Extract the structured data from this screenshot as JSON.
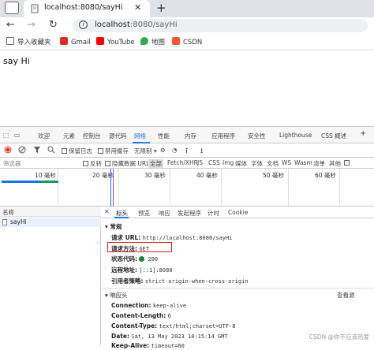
{
  "browser": {
    "tab_title": "localhost:8080/sayHi",
    "url_host": "localhost",
    "url_path": ":8080/sayHi"
  },
  "bookmarks": [
    {
      "label": "导入收藏夹",
      "icon": "import-bookmarks-icon",
      "color": "#666"
    },
    {
      "label": "Gmail",
      "icon": "gmail-icon",
      "color": "#d93025"
    },
    {
      "label": "YouTube",
      "icon": "youtube-icon",
      "color": "#ff0000"
    },
    {
      "label": "地图",
      "icon": "maps-icon",
      "color": "#34a853"
    },
    {
      "label": "CSDN",
      "icon": "csdn-icon",
      "color": "#fc5531"
    }
  ],
  "page": {
    "text": "say Hi"
  },
  "devtools": {
    "tabs": [
      "欢迎",
      "元素",
      "控制台",
      "源代码",
      "网络",
      "性能",
      "内存",
      "应用程序",
      "安全性",
      "Lighthouse",
      "CSS 概述"
    ],
    "toolbar": {
      "preserve_log": "保留日志",
      "disable_cache": "禁用缓存",
      "throttle": "无限制"
    },
    "filter": {
      "placeholder": "筛选器",
      "invert": "反转",
      "hide_data_urls": "隐藏数据 URL",
      "types": [
        "全部",
        "Fetch/XHR",
        "JS",
        "CSS",
        "Img",
        "媒体",
        "字体",
        "文档",
        "WS",
        "Wasm",
        "清单",
        "其他"
      ]
    },
    "timeline_ticks": [
      "10 毫秒",
      "20 毫秒",
      "30 毫秒",
      "40 毫秒",
      "50 毫秒",
      "60 毫秒"
    ],
    "requests": {
      "header": "名称",
      "items": [
        "sayHi"
      ]
    },
    "detail_tabs": [
      "标头",
      "预览",
      "响应",
      "发起程序",
      "计时",
      "Cookie"
    ],
    "general": {
      "title": "常规",
      "url_label": "请求 URL:",
      "url_value": "http://localhost:8080/sayHi",
      "method_label": "请求方法:",
      "method_value": "GET",
      "status_label": "状态代码:",
      "status_value": "200",
      "remote_label": "远程地址:",
      "remote_value": "[::1]:8080",
      "referrer_label": "引用者策略:",
      "referrer_value": "strict-origin-when-cross-origin"
    },
    "response_headers": {
      "title": "响应头",
      "view_source": "查看源",
      "items": [
        {
          "k": "Connection:",
          "v": "keep-alive"
        },
        {
          "k": "Content-Length:",
          "v": "6"
        },
        {
          "k": "Content-Type:",
          "v": "text/html;charset=UTF-8"
        },
        {
          "k": "Date:",
          "v": "Sat, 13 May 2023 10:15:14 GMT"
        },
        {
          "k": "Keep-Alive:",
          "v": "timeout=60"
        }
      ]
    },
    "watermark": "CSDN @你不应该热爱"
  }
}
